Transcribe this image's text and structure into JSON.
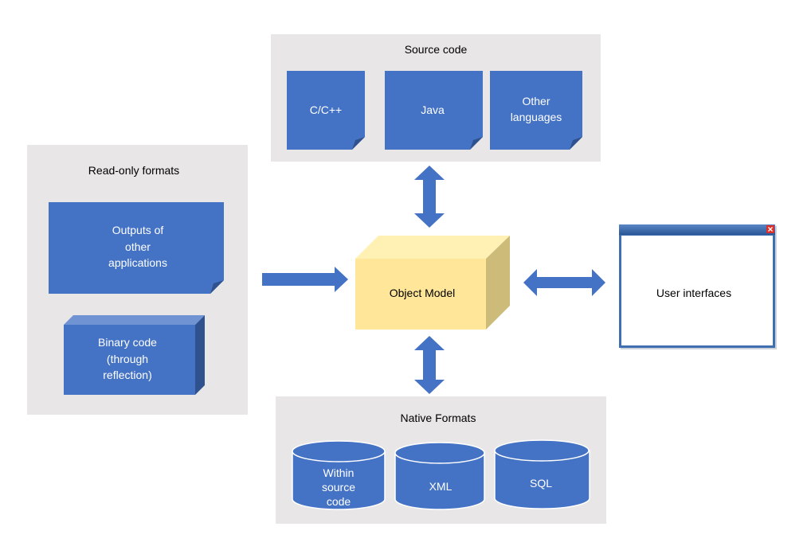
{
  "colors": {
    "panel": "#e8e6e7",
    "blue": "#4472c4",
    "blue_dark": "#2f528f",
    "model_front": "#ffe699",
    "model_top": "#fff0b3",
    "model_side": "#cdbb7a"
  },
  "source_code": {
    "title": "Source code",
    "items": [
      [
        "C/C++"
      ],
      [
        "Java"
      ],
      [
        "Other",
        "languages"
      ]
    ]
  },
  "read_only": {
    "title": "Read-only formats",
    "outputs": [
      "Outputs of",
      "other",
      "applications"
    ],
    "binary": [
      "Binary code",
      "(through",
      "reflection)"
    ]
  },
  "object_model": {
    "label": "Object Model"
  },
  "user_interfaces": {
    "label": "User interfaces",
    "close_icon": "close-icon"
  },
  "native_formats": {
    "title": "Native Formats",
    "items": [
      [
        "Within",
        "source",
        "code"
      ],
      [
        "XML"
      ],
      [
        "SQL"
      ]
    ]
  }
}
